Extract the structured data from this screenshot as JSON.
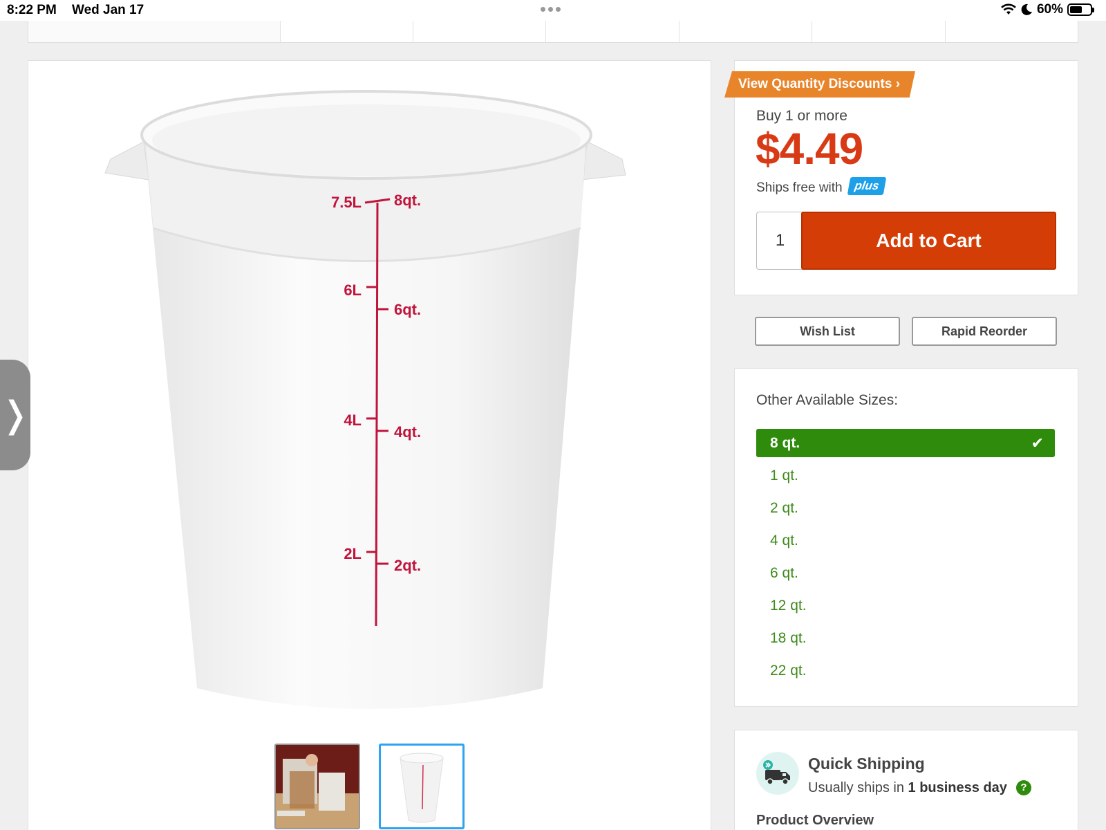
{
  "status_bar": {
    "time": "8:22 PM",
    "date": "Wed Jan 17",
    "battery": "60%"
  },
  "product_image": {
    "markings_left": [
      "7.5L",
      "6L",
      "4L",
      "2L"
    ],
    "markings_right": [
      "8qt.",
      "6qt.",
      "4qt.",
      "2qt."
    ]
  },
  "pricing": {
    "discount_label": "View Quantity Discounts",
    "buy_label": "Buy 1 or more",
    "price": "$4.49",
    "ships_free": "Ships free with",
    "plus": "plus",
    "quantity": "1",
    "add_to_cart": "Add to Cart"
  },
  "actions": {
    "wish_list": "Wish List",
    "rapid_reorder": "Rapid Reorder"
  },
  "sizes": {
    "title": "Other Available Sizes:",
    "selected": "8 qt.",
    "options": [
      "1 qt.",
      "2 qt.",
      "4 qt.",
      "6 qt.",
      "12 qt.",
      "18 qt.",
      "22 qt."
    ]
  },
  "shipping": {
    "title": "Quick Shipping",
    "sub_prefix": "Usually ships in",
    "sub_bold": "1 business day",
    "help": "?"
  },
  "overview_label": "Product Overview",
  "colors": {
    "price": "#d93a16",
    "cart": "#d43d06",
    "selected": "#2e8b0b",
    "discount": "#e8842a",
    "plus": "#1ea0e8"
  }
}
